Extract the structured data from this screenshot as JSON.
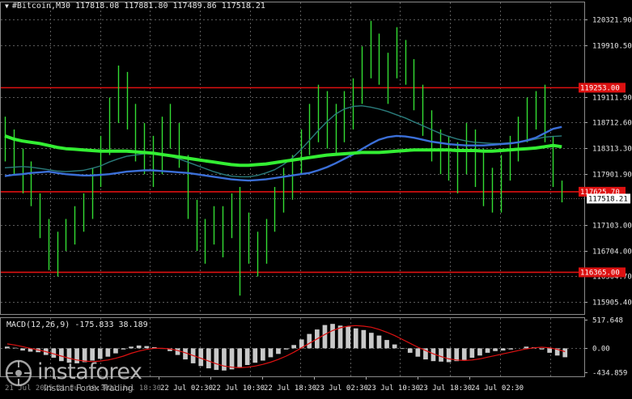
{
  "header": {
    "symbol": "#Bitcoin,M30",
    "ohlc": "117818.08 117881.80 117489.86 117518.21"
  },
  "colors": {
    "background": "#000000",
    "grid": "#5a5a5a",
    "candle": "#33dd33",
    "ma_thick": "#33ee33",
    "ma_blue": "#3b6fd8",
    "ma_teal": "#2a7b7b",
    "level": "#dd1111",
    "macd_hist": "#c8c8c8",
    "macd_signal": "#dd1111"
  },
  "chart_data": [
    {
      "type": "candlestick",
      "title": "#Bitcoin,M30",
      "ylim": [
        115700,
        120600
      ],
      "y_ticks": [
        "120321.90",
        "119910.50",
        "119111.90",
        "118712.60",
        "118313.30",
        "117901.90",
        "117103.00",
        "116704.00",
        "116304.70",
        "115905.40"
      ],
      "levels": [
        {
          "value": 119253.0,
          "label": "119253.00"
        },
        {
          "value": 117625.7,
          "label": "117625.70"
        },
        {
          "value": 116365.0,
          "label": "116365.00"
        }
      ],
      "current_price": {
        "value": 117518.21,
        "label": "117518.21"
      },
      "x_labels": [
        "21 Jul 2025",
        "21 Jul 10:30",
        "21 Jul 18:30",
        "22 Jul 02:30",
        "22 Jul 10:30",
        "22 Jul 18:30",
        "23 Jul 02:30",
        "23 Jul 10:30",
        "23 Jul 18:30",
        "24 Jul 02:30"
      ],
      "candles": [
        {
          "h": 118800,
          "l": 118100
        },
        {
          "h": 118600,
          "l": 117900
        },
        {
          "h": 118300,
          "l": 117600
        },
        {
          "h": 118100,
          "l": 117400
        },
        {
          "h": 117600,
          "l": 116900
        },
        {
          "h": 117200,
          "l": 116400
        },
        {
          "h": 117000,
          "l": 116300
        },
        {
          "h": 117200,
          "l": 116700
        },
        {
          "h": 117400,
          "l": 116800
        },
        {
          "h": 117600,
          "l": 117000
        },
        {
          "h": 118000,
          "l": 117200
        },
        {
          "h": 118500,
          "l": 117700
        },
        {
          "h": 119100,
          "l": 118200
        },
        {
          "h": 119600,
          "l": 118700
        },
        {
          "h": 119500,
          "l": 118600
        },
        {
          "h": 119000,
          "l": 118100
        },
        {
          "h": 118700,
          "l": 117900
        },
        {
          "h": 118500,
          "l": 117700
        },
        {
          "h": 118800,
          "l": 117900
        },
        {
          "h": 119000,
          "l": 118300
        },
        {
          "h": 118700,
          "l": 118000
        },
        {
          "h": 118200,
          "l": 117200
        },
        {
          "h": 117500,
          "l": 116700
        },
        {
          "h": 117200,
          "l": 116500
        },
        {
          "h": 117400,
          "l": 116800
        },
        {
          "h": 117400,
          "l": 116600
        },
        {
          "h": 117600,
          "l": 116900
        },
        {
          "h": 117700,
          "l": 116000
        },
        {
          "h": 117300,
          "l": 116500
        },
        {
          "h": 117000,
          "l": 116300
        },
        {
          "h": 117200,
          "l": 116500
        },
        {
          "h": 117700,
          "l": 117000
        },
        {
          "h": 118000,
          "l": 117300
        },
        {
          "h": 118200,
          "l": 117500
        },
        {
          "h": 118600,
          "l": 117900
        },
        {
          "h": 119000,
          "l": 118200
        },
        {
          "h": 119300,
          "l": 118400
        },
        {
          "h": 119200,
          "l": 118300
        },
        {
          "h": 119000,
          "l": 118200
        },
        {
          "h": 119200,
          "l": 118400
        },
        {
          "h": 119400,
          "l": 118600
        },
        {
          "h": 119900,
          "l": 119000
        },
        {
          "h": 120300,
          "l": 119400
        },
        {
          "h": 120100,
          "l": 119300
        },
        {
          "h": 119800,
          "l": 119000
        },
        {
          "h": 120200,
          "l": 119400
        },
        {
          "h": 120000,
          "l": 119300
        },
        {
          "h": 119700,
          "l": 118900
        },
        {
          "h": 119300,
          "l": 118500
        },
        {
          "h": 118900,
          "l": 118100
        },
        {
          "h": 118600,
          "l": 117900
        },
        {
          "h": 118500,
          "l": 117800
        },
        {
          "h": 118400,
          "l": 117600
        },
        {
          "h": 118700,
          "l": 117900
        },
        {
          "h": 118600,
          "l": 117700
        },
        {
          "h": 118300,
          "l": 117400
        },
        {
          "h": 118000,
          "l": 117300
        },
        {
          "h": 118200,
          "l": 117300
        },
        {
          "h": 118500,
          "l": 117800
        },
        {
          "h": 118800,
          "l": 118100
        },
        {
          "h": 119100,
          "l": 118400
        },
        {
          "h": 119200,
          "l": 118600
        },
        {
          "h": 119300,
          "l": 118400
        },
        {
          "h": 118500,
          "l": 117700
        },
        {
          "h": 117800,
          "l": 117460
        }
      ],
      "series": [
        {
          "name": "",
          "color": "#33ee33",
          "values": [
            118500,
            118450,
            118420,
            118400,
            118380,
            118350,
            118320,
            118300,
            118290,
            118280,
            118270,
            118260,
            118260,
            118260,
            118260,
            118250,
            118240,
            118230,
            118210,
            118190,
            118170,
            118150,
            118130,
            118110,
            118090,
            118070,
            118050,
            118040,
            118040,
            118050,
            118060,
            118080,
            118100,
            118120,
            118140,
            118160,
            118180,
            118200,
            118210,
            118220,
            118230,
            118240,
            118240,
            118240,
            118250,
            118260,
            118270,
            118280,
            118280,
            118280,
            118280,
            118280,
            118270,
            118270,
            118270,
            118260,
            118260,
            118270,
            118280,
            118290,
            118300,
            118310,
            118330,
            118350,
            118330
          ]
        },
        {
          "name": "",
          "color": "#3b6fd8",
          "values": [
            117870,
            117890,
            117900,
            117920,
            117930,
            117940,
            117920,
            117900,
            117890,
            117880,
            117880,
            117890,
            117900,
            117920,
            117940,
            117950,
            117960,
            117960,
            117950,
            117940,
            117930,
            117920,
            117900,
            117880,
            117860,
            117840,
            117820,
            117810,
            117800,
            117810,
            117820,
            117840,
            117860,
            117880,
            117900,
            117920,
            117960,
            118010,
            118070,
            118140,
            118210,
            118290,
            118370,
            118440,
            118480,
            118500,
            118490,
            118470,
            118440,
            118410,
            118390,
            118370,
            118360,
            118350,
            118350,
            118350,
            118360,
            118370,
            118380,
            118400,
            118430,
            118470,
            118540,
            118610,
            118640
          ]
        },
        {
          "name": "",
          "color": "#2a7b7b",
          "values": [
            118000,
            118010,
            118020,
            118010,
            117990,
            117970,
            117950,
            117940,
            117950,
            117960,
            117990,
            118030,
            118090,
            118140,
            118180,
            118200,
            118220,
            118230,
            118210,
            118180,
            118140,
            118090,
            118040,
            117990,
            117940,
            117900,
            117870,
            117860,
            117860,
            117880,
            117920,
            117970,
            118050,
            118150,
            118280,
            118430,
            118580,
            118720,
            118840,
            118920,
            118960,
            118970,
            118950,
            118920,
            118880,
            118830,
            118780,
            118720,
            118660,
            118600,
            118540,
            118490,
            118450,
            118420,
            118400,
            118390,
            118380,
            118380,
            118390,
            118400,
            118420,
            118450,
            118480,
            118490,
            118500
          ]
        }
      ]
    },
    {
      "type": "bar",
      "title": "MACD(12,26,9)",
      "header_values": "-175.833 38.189",
      "ylim": [
        -520,
        560
      ],
      "y_ticks": [
        "517.648",
        "0.00",
        "-434.859"
      ],
      "values": [
        30,
        10,
        -40,
        -60,
        -70,
        -120,
        -170,
        -230,
        -260,
        -270,
        -250,
        -220,
        -190,
        -150,
        -90,
        -20,
        30,
        50,
        40,
        20,
        -10,
        -50,
        -120,
        -200,
        -270,
        -320,
        -360,
        -390,
        -400,
        -380,
        -340,
        -300,
        -260,
        -220,
        -160,
        -100,
        -20,
        60,
        160,
        260,
        340,
        420,
        440,
        410,
        390,
        360,
        330,
        280,
        230,
        150,
        70,
        -10,
        -80,
        -150,
        -200,
        -230,
        -240,
        -250,
        -230,
        -210,
        -170,
        -130,
        -80,
        -50,
        -40,
        -20,
        0,
        30,
        20,
        -20,
        -80,
        -130,
        -160
      ],
      "series": [
        {
          "name": "",
          "color": "#dd1111",
          "values": [
            80,
            60,
            30,
            0,
            -30,
            -60,
            -100,
            -140,
            -180,
            -210,
            -230,
            -240,
            -230,
            -210,
            -180,
            -140,
            -90,
            -50,
            -20,
            0,
            0,
            -10,
            -40,
            -80,
            -130,
            -180,
            -230,
            -280,
            -320,
            -340,
            -350,
            -340,
            -320,
            -290,
            -250,
            -200,
            -140,
            -70,
            10,
            90,
            170,
            250,
            320,
            370,
            400,
            410,
            400,
            380,
            340,
            290,
            230,
            160,
            90,
            20,
            -40,
            -100,
            -150,
            -190,
            -210,
            -220,
            -210,
            -190,
            -160,
            -130,
            -100,
            -70,
            -40,
            -10,
            10,
            20,
            10,
            -20,
            -60
          ]
        }
      ]
    }
  ],
  "branding": {
    "name": "instaforex",
    "tagline": "Instant Forex Trading"
  }
}
